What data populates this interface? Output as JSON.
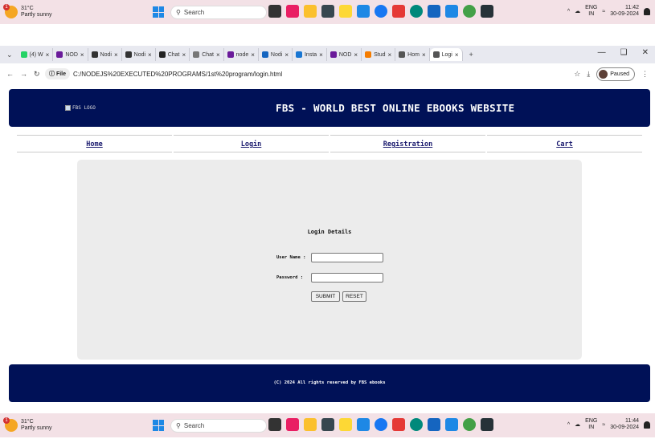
{
  "taskbar_top": {
    "temp": "31°C",
    "weather": "Partly sunny",
    "search": "Search",
    "lang1": "ENG",
    "lang2": "IN",
    "time": "11:42",
    "date": "30-09-2024"
  },
  "taskbar_bottom": {
    "temp": "31°C",
    "weather": "Partly sunny",
    "search": "Search",
    "lang1": "ENG",
    "lang2": "IN",
    "time": "11:44",
    "date": "30-09-2024"
  },
  "tabs": [
    {
      "label": "(4) W",
      "color": "#25d366"
    },
    {
      "label": "NOD",
      "color": "#6a1b9a"
    },
    {
      "label": "Nodi",
      "color": "#333333"
    },
    {
      "label": "Nodi",
      "color": "#333333"
    },
    {
      "label": "Chat",
      "color": "#222222"
    },
    {
      "label": "Chat",
      "color": "#777777"
    },
    {
      "label": "node",
      "color": "#6a1b9a"
    },
    {
      "label": "Nodi",
      "color": "#1565c0"
    },
    {
      "label": "Insta",
      "color": "#1976d2"
    },
    {
      "label": "NOD",
      "color": "#6a1b9a"
    },
    {
      "label": "Stud",
      "color": "#f57c00"
    },
    {
      "label": "Hom",
      "color": "#555555"
    },
    {
      "label": "Logi",
      "color": "#555555",
      "active": true
    }
  ],
  "browser": {
    "file_label": "File",
    "url": "C:/NODEJS%20EXECUTED%20PROGRAMS/1st%20program/login.html",
    "paused": "Paused",
    "new_tab": "+"
  },
  "site": {
    "logo_alt": "FBS LOGO",
    "title": "FBS - WORLD BEST ONLINE EBOOKS WEBSITE",
    "nav": [
      "Home",
      "Login",
      "Registration",
      "Cart"
    ],
    "login": {
      "heading": "Login Details",
      "user_label": "User Name :",
      "pass_label": "Password :",
      "submit": "SUBMIT",
      "reset": "RESET"
    },
    "footer": "(C) 2024 All rights reserved by FBS ebooks"
  },
  "colors": {
    "header_bg": "#001157",
    "panel_bg": "#ececec",
    "taskbar_bg": "#f3e1e6"
  }
}
